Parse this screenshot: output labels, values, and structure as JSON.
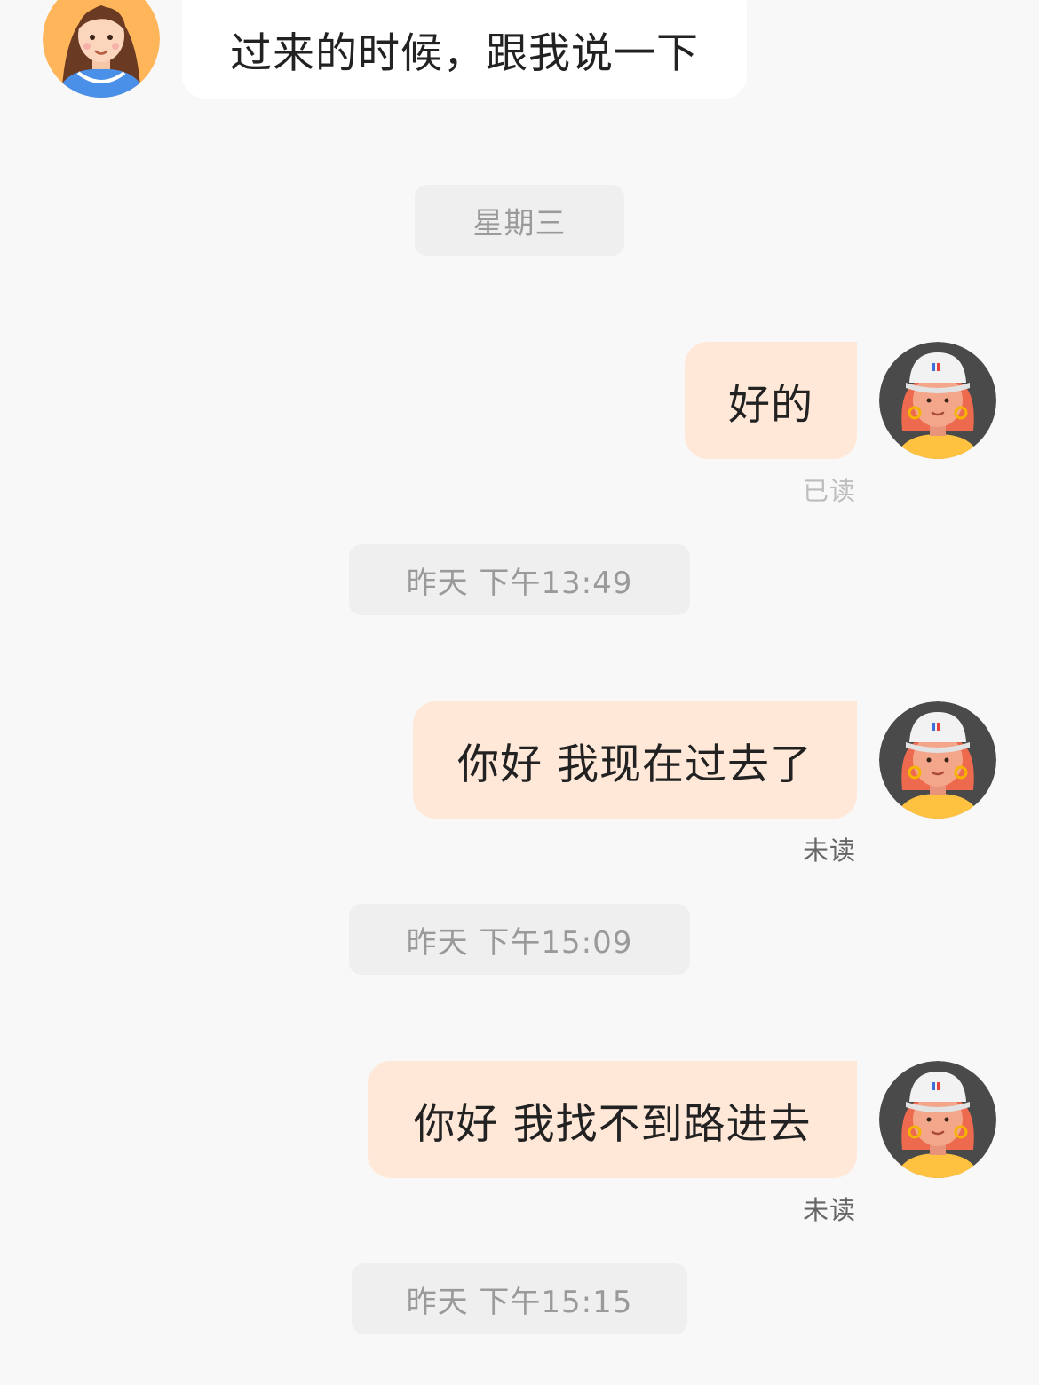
{
  "conversation": {
    "messages": [
      {
        "direction": "incoming",
        "text": "过来的时候，跟我说一下"
      },
      {
        "direction": "outgoing",
        "text": "好的",
        "status": "已读"
      },
      {
        "direction": "outgoing",
        "text": "你好 我现在过去了",
        "status": "未读"
      },
      {
        "direction": "outgoing",
        "text": "你好 我找不到路进去",
        "status": "未读"
      }
    ],
    "separators": [
      "星期三",
      "昨天 下午13:49",
      "昨天 下午15:09",
      "昨天 下午15:15"
    ]
  },
  "avatars": {
    "contact_icon": "woman-brown-hair-avatar-icon",
    "self_icon": "woman-white-cap-avatar-icon"
  },
  "colors": {
    "background": "#f8f8f8",
    "incoming_bubble": "#ffffff",
    "outgoing_bubble": "#ffe8d8",
    "separator": "#efefef",
    "read_text": "#bdbdbd",
    "unread_text": "#666666"
  }
}
